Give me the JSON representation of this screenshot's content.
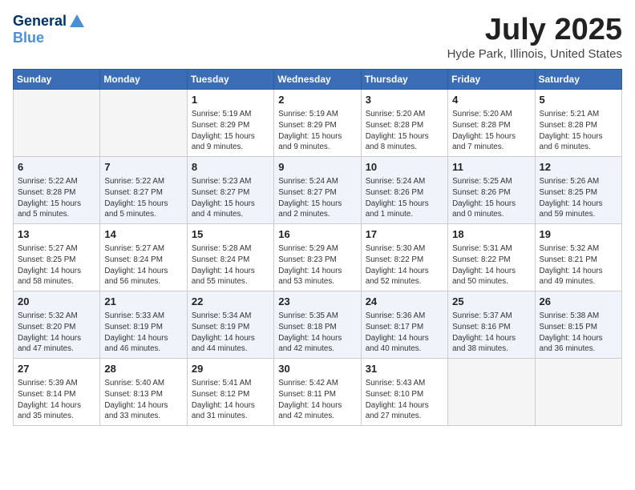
{
  "header": {
    "logo_line1": "General",
    "logo_line2": "Blue",
    "month": "July 2025",
    "location": "Hyde Park, Illinois, United States"
  },
  "days_of_week": [
    "Sunday",
    "Monday",
    "Tuesday",
    "Wednesday",
    "Thursday",
    "Friday",
    "Saturday"
  ],
  "weeks": [
    [
      {
        "day": "",
        "info": ""
      },
      {
        "day": "",
        "info": ""
      },
      {
        "day": "1",
        "info": "Sunrise: 5:19 AM\nSunset: 8:29 PM\nDaylight: 15 hours and 9 minutes."
      },
      {
        "day": "2",
        "info": "Sunrise: 5:19 AM\nSunset: 8:29 PM\nDaylight: 15 hours and 9 minutes."
      },
      {
        "day": "3",
        "info": "Sunrise: 5:20 AM\nSunset: 8:28 PM\nDaylight: 15 hours and 8 minutes."
      },
      {
        "day": "4",
        "info": "Sunrise: 5:20 AM\nSunset: 8:28 PM\nDaylight: 15 hours and 7 minutes."
      },
      {
        "day": "5",
        "info": "Sunrise: 5:21 AM\nSunset: 8:28 PM\nDaylight: 15 hours and 6 minutes."
      }
    ],
    [
      {
        "day": "6",
        "info": "Sunrise: 5:22 AM\nSunset: 8:28 PM\nDaylight: 15 hours and 5 minutes."
      },
      {
        "day": "7",
        "info": "Sunrise: 5:22 AM\nSunset: 8:27 PM\nDaylight: 15 hours and 5 minutes."
      },
      {
        "day": "8",
        "info": "Sunrise: 5:23 AM\nSunset: 8:27 PM\nDaylight: 15 hours and 4 minutes."
      },
      {
        "day": "9",
        "info": "Sunrise: 5:24 AM\nSunset: 8:27 PM\nDaylight: 15 hours and 2 minutes."
      },
      {
        "day": "10",
        "info": "Sunrise: 5:24 AM\nSunset: 8:26 PM\nDaylight: 15 hours and 1 minute."
      },
      {
        "day": "11",
        "info": "Sunrise: 5:25 AM\nSunset: 8:26 PM\nDaylight: 15 hours and 0 minutes."
      },
      {
        "day": "12",
        "info": "Sunrise: 5:26 AM\nSunset: 8:25 PM\nDaylight: 14 hours and 59 minutes."
      }
    ],
    [
      {
        "day": "13",
        "info": "Sunrise: 5:27 AM\nSunset: 8:25 PM\nDaylight: 14 hours and 58 minutes."
      },
      {
        "day": "14",
        "info": "Sunrise: 5:27 AM\nSunset: 8:24 PM\nDaylight: 14 hours and 56 minutes."
      },
      {
        "day": "15",
        "info": "Sunrise: 5:28 AM\nSunset: 8:24 PM\nDaylight: 14 hours and 55 minutes."
      },
      {
        "day": "16",
        "info": "Sunrise: 5:29 AM\nSunset: 8:23 PM\nDaylight: 14 hours and 53 minutes."
      },
      {
        "day": "17",
        "info": "Sunrise: 5:30 AM\nSunset: 8:22 PM\nDaylight: 14 hours and 52 minutes."
      },
      {
        "day": "18",
        "info": "Sunrise: 5:31 AM\nSunset: 8:22 PM\nDaylight: 14 hours and 50 minutes."
      },
      {
        "day": "19",
        "info": "Sunrise: 5:32 AM\nSunset: 8:21 PM\nDaylight: 14 hours and 49 minutes."
      }
    ],
    [
      {
        "day": "20",
        "info": "Sunrise: 5:32 AM\nSunset: 8:20 PM\nDaylight: 14 hours and 47 minutes."
      },
      {
        "day": "21",
        "info": "Sunrise: 5:33 AM\nSunset: 8:19 PM\nDaylight: 14 hours and 46 minutes."
      },
      {
        "day": "22",
        "info": "Sunrise: 5:34 AM\nSunset: 8:19 PM\nDaylight: 14 hours and 44 minutes."
      },
      {
        "day": "23",
        "info": "Sunrise: 5:35 AM\nSunset: 8:18 PM\nDaylight: 14 hours and 42 minutes."
      },
      {
        "day": "24",
        "info": "Sunrise: 5:36 AM\nSunset: 8:17 PM\nDaylight: 14 hours and 40 minutes."
      },
      {
        "day": "25",
        "info": "Sunrise: 5:37 AM\nSunset: 8:16 PM\nDaylight: 14 hours and 38 minutes."
      },
      {
        "day": "26",
        "info": "Sunrise: 5:38 AM\nSunset: 8:15 PM\nDaylight: 14 hours and 36 minutes."
      }
    ],
    [
      {
        "day": "27",
        "info": "Sunrise: 5:39 AM\nSunset: 8:14 PM\nDaylight: 14 hours and 35 minutes."
      },
      {
        "day": "28",
        "info": "Sunrise: 5:40 AM\nSunset: 8:13 PM\nDaylight: 14 hours and 33 minutes."
      },
      {
        "day": "29",
        "info": "Sunrise: 5:41 AM\nSunset: 8:12 PM\nDaylight: 14 hours and 31 minutes."
      },
      {
        "day": "30",
        "info": "Sunrise: 5:42 AM\nSunset: 8:11 PM\nDaylight: 14 hours and 42 minutes."
      },
      {
        "day": "31",
        "info": "Sunrise: 5:43 AM\nSunset: 8:10 PM\nDaylight: 14 hours and 27 minutes."
      },
      {
        "day": "",
        "info": ""
      },
      {
        "day": "",
        "info": ""
      }
    ]
  ]
}
